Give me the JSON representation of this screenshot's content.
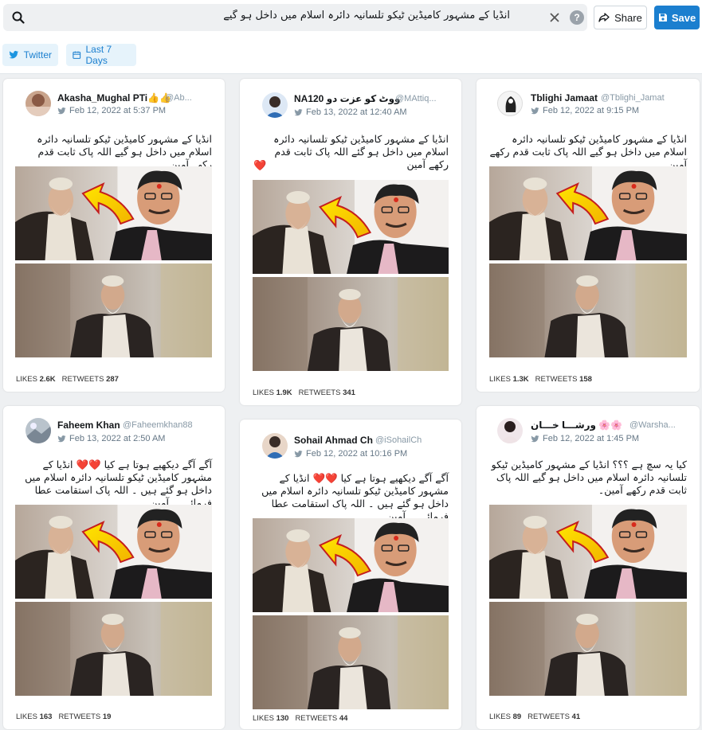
{
  "search": {
    "query": "انڈیا کے مشہور کامیڈین ٹیکو تلسانیہ دائرہ اسلام میں داخل ہو گیے"
  },
  "actions": {
    "share_label": "Share",
    "save_label": "Save",
    "help_glyph": "?"
  },
  "filters": {
    "source_label": "Twitter",
    "range_label": "Last 7 Days"
  },
  "colors": {
    "accent": "#1b7fcf",
    "filter_bg": "#e6f3fb",
    "board_bg": "#eef0f2",
    "heart": "#e0245e"
  },
  "icons": [
    "search-icon",
    "close-icon",
    "help-icon",
    "share-icon",
    "save-icon",
    "twitter-icon",
    "calendar-icon",
    "heart-icon"
  ],
  "stat_labels": {
    "likes": "LIKES",
    "retweets": "RETWEETS"
  },
  "cards": [
    {
      "username": "Akasha_Mughal PTi👍👍",
      "handle": "@Ab...",
      "date": "Feb 12, 2022 at 5:37 PM",
      "text": "انڈیا کے مشہور کامیڈین ٹیکو تلسانیہ دائرہ اسلام میں داخل ہو گیے اللہ پاک ثابت قدم رکھے آمین۔",
      "likes": "2.6K",
      "retweets": "287"
    },
    {
      "username": "NA120 ووٹ کو عزت دو",
      "handle": "@MAttiq...",
      "date": "Feb 13, 2022 at 12:40 AM",
      "text": "انڈیا کے مشہور کامیڈین ٹیکو تلسانیہ دائرہ اسلام میں داخل ہو گئے اللہ پاک ثابت قدم رکھے آمین",
      "emoji": "❤️",
      "likes": "1.9K",
      "retweets": "341"
    },
    {
      "username": "Tblighi Jamaat",
      "handle": "@Tblighi_Jamat",
      "date": "Feb 12, 2022 at 9:15 PM",
      "text": "انڈیا کے مشہور کامیڈین ٹیکو تلسانیہ دائرہ اسلام میں داخل ہو گیے اللہ پاک ثابت قدم رکھے آمین۔",
      "likes": "1.3K",
      "retweets": "158"
    },
    {
      "username": "Faheem Khan",
      "handle": "@Faheemkhan88",
      "date": "Feb 13, 2022 at 2:50 AM",
      "text": "آگے آگے دیکھیے ہوتا ہے کیا ❤️❤️ انڈیا کے مشہور کامیڈین ٹیکو تلسانیہ دائرہ اسلام میں داخل ہو گئے ہیں ۔ اللہ پاک استقامت عطا فرمائے ....آمین",
      "likes": "163",
      "retweets": "19"
    },
    {
      "username": "Sohail Ahmad Ch",
      "handle": "@iSohailCh",
      "date": "Feb 12, 2022 at 10:16 PM",
      "text": "آگے آگے دیکھیے ہوتا ہے کیا ❤️❤️ انڈیا کے مشہور کامیڈین ٹیکو تلسانیہ دائرہ اسلام میں داخل ہو گئے ہیں ۔ اللہ پاک استقامت عطا فرمائے ....آمین",
      "likes": "130",
      "retweets": "44"
    },
    {
      "username": "ورشـــا خـــان 🌸🌸",
      "handle": "@Warsha...",
      "date": "Feb 12, 2022 at 1:45 PM",
      "text": "کیا یہ سچ ہے ؟؟؟ انڈیا کے مشہور کامیڈین ٹیکو تلسانیہ دائرہ اسلام میں داخل ہو گیے اللہ پاک ثابت قدم رکھے آمین۔",
      "likes": "89",
      "retweets": "41"
    }
  ]
}
